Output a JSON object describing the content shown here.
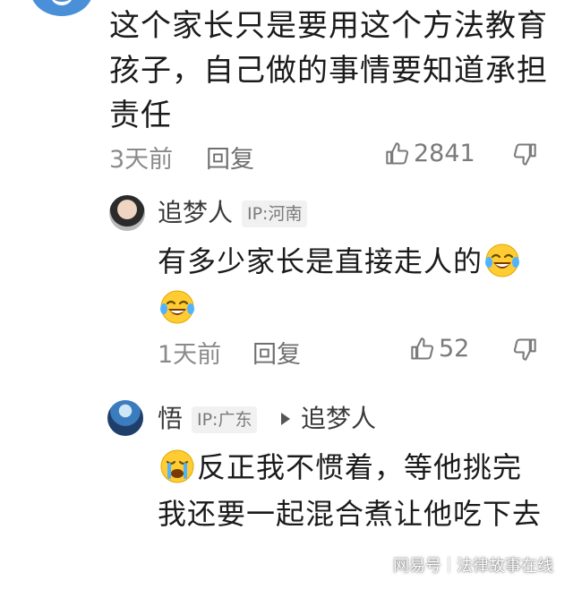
{
  "top_comment": {
    "text": "这个家长只是要用这个方法教育孩子，自己做的事情要知道承担责任",
    "time": "3天前",
    "reply_label": "回复",
    "likes": "2841"
  },
  "replies": [
    {
      "username": "追梦人",
      "ip": "IP:河南",
      "text_before": "有多少家长是直接走人的",
      "emoji_names": [
        "laughing-crying-emoji",
        "laughing-crying-emoji"
      ],
      "time": "1天前",
      "reply_label": "回复",
      "likes": "52"
    },
    {
      "username": "悟",
      "ip": "IP:广东",
      "reply_to": "追梦人",
      "text_after_emoji": "反正我不惯着，等他挑完我还要一起混合煮让他吃下去",
      "emoji_names": [
        "crying-emoji"
      ]
    }
  ],
  "watermark": {
    "brand": "网易号",
    "account": "法律故事在线"
  },
  "colors": {
    "text_primary": "#1b1b1b",
    "text_meta": "#8a8a8a",
    "badge_bg": "#f1f1f1"
  }
}
